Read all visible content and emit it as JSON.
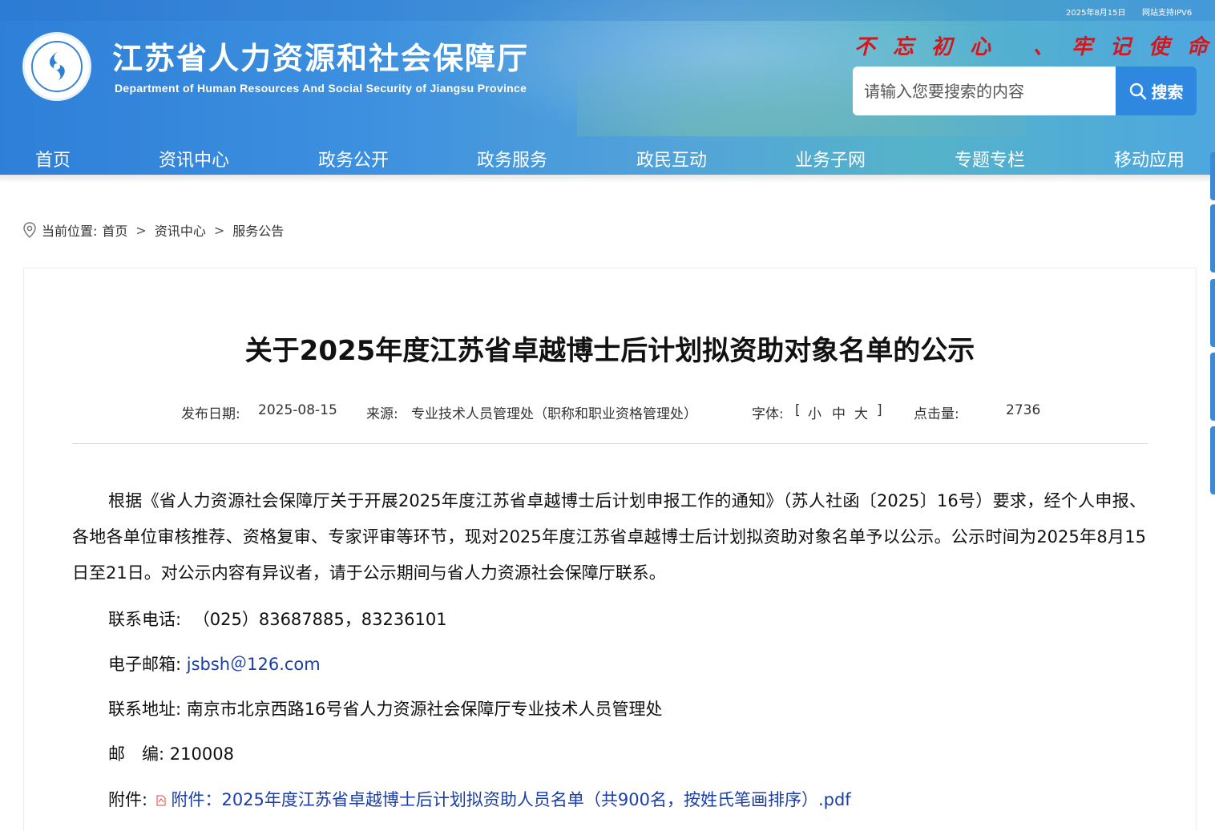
{
  "header": {
    "top_date": "2025年8月15日",
    "top_ipv6": "网站支持IPV6",
    "site_title": "江苏省人力资源和社会保障厅",
    "site_subtitle": "Department of Human Resources And Social Security of Jiangsu Province",
    "slogan": "不忘初心 、牢记使命",
    "search_placeholder": "请输入您要搜索的内容",
    "search_button": "搜索"
  },
  "nav": {
    "items": [
      "首页",
      "资讯中心",
      "政务公开",
      "政务服务",
      "政民互动",
      "业务子网",
      "专题专栏",
      "移动应用"
    ]
  },
  "breadcrumb": {
    "label": "当前位置:",
    "items": [
      "首页",
      "资讯中心",
      "服务公告"
    ],
    "separator": ">"
  },
  "article": {
    "title": "关于2025年度江苏省卓越博士后计划拟资助对象名单的公示",
    "meta": {
      "date_label": "发布日期:",
      "date": "2025-08-15",
      "source_label": "来源:",
      "source": "专业技术人员管理处（职称和职业资格管理处）",
      "font_label": "字体:",
      "font_open": "[",
      "font_small": "小",
      "font_medium": "中",
      "font_large": "大",
      "font_close": "]",
      "views_label": "点击量:",
      "views": "2736"
    },
    "paragraph": "根据《省人力资源社会保障厅关于开展2025年度江苏省卓越博士后计划申报工作的通知》（苏人社函〔2025〕16号）要求，经个人申报、各地各单位审核推荐、资格复审、专家评审等环节，现对2025年度江苏省卓越博士后计划拟资助对象名单予以公示。公示时间为2025年8月15日至21日。对公示内容有异议者，请于公示期间与省人力资源社会保障厅联系。",
    "phone_label": "联系电话:",
    "phone": "（025）83687885，83236101",
    "email_label": "电子邮箱:",
    "email": "jsbsh＠126.com",
    "address_label": "联系地址:",
    "address": "南京市北京西路16号省人力资源社会保障厅专业技术人员管理处",
    "postcode_label": "邮　编:",
    "postcode": "210008",
    "attachment_label": "附件:",
    "attachment_link": "附件：2025年度江苏省卓越博士后计划拟资助人员名单（共900名，按姓氏笔画排序）.pdf"
  },
  "colors": {
    "header_blue": "#3d90df",
    "slogan_red": "#d6161b",
    "search_button": "#2e88e0",
    "link_blue": "#1a3ea8"
  },
  "icons": [
    "location-pin-icon",
    "search-icon",
    "pdf-icon",
    "emblem-logo"
  ]
}
